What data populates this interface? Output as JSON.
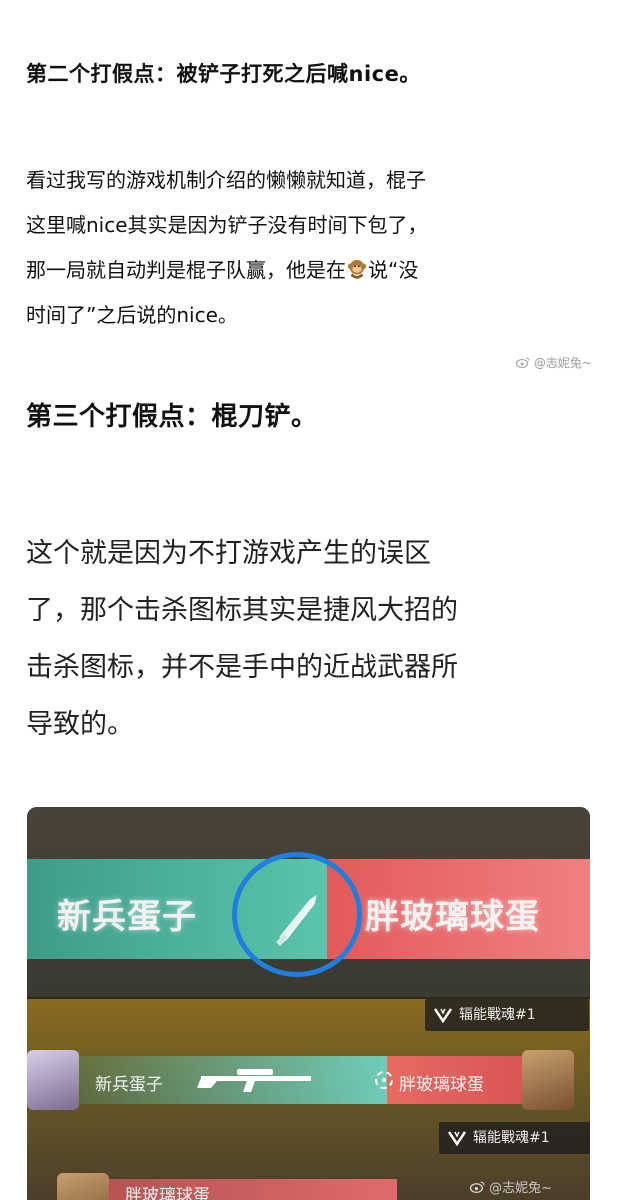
{
  "heading2": "第二个打假点：被铲子打死之后喊nice。",
  "paragraph1": [
    "看过我写的游戏机制介绍的懒懒就知道，棍子",
    "这里喊nice其实是因为铲子没有时间下包了，",
    "那一局就自动判是棍子队赢，他是在",
    "说“没",
    "时间了”之后说的nice。"
  ],
  "watermark1": "@志妮兔~",
  "heading3": "第三个打假点：棍刀铲。",
  "paragraph2": [
    "这个就是因为不打游戏产生的误区",
    "了，那个击杀图标其实是捷风大招的",
    "击杀图标，并不是手中的近战武器所",
    "导致的。"
  ],
  "screenshot": {
    "banner_left": "新兵蛋子",
    "banner_right": "胖玻璃球蛋",
    "killfeed": [
      {
        "tag": "辐能戰魂#1",
        "left": "新兵蛋子",
        "right": "胖玻璃球蛋"
      },
      {
        "tag": "辐能戰魂#1",
        "left": "",
        "right": "胖玻璃球蛋"
      }
    ]
  },
  "watermark2": "@志妮兔~",
  "colors": {
    "teal": "#5cc7b0",
    "red": "#e35a5a",
    "circle_blue": "#1f7fe0"
  },
  "icons": [
    "monkey-emoji",
    "knife-icon",
    "sniper-rifle-icon",
    "crosshair-icon",
    "rank-badge-icon",
    "weibo-logo-icon"
  ]
}
